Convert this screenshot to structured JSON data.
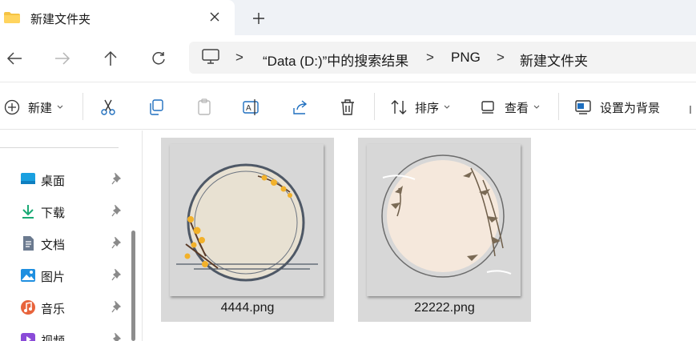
{
  "tab": {
    "title": "新建文件夹",
    "close_glyph": "✕",
    "new_tab_glyph": "+"
  },
  "address": {
    "crumbs": [
      "“Data (D:)”中的搜索结果",
      "PNG",
      "新建文件夹"
    ],
    "separator": ">"
  },
  "commands": {
    "new_label": "新建",
    "sort_label": "排序",
    "view_label": "查看",
    "wallpaper_label": "设置为背景"
  },
  "sidebar": {
    "items": [
      {
        "label": "桌面",
        "icon": "desktop-icon",
        "color": "#1aa0e0"
      },
      {
        "label": "下载",
        "icon": "download-icon",
        "color": "#19a974"
      },
      {
        "label": "文档",
        "icon": "document-icon",
        "color": "#6b7a8f"
      },
      {
        "label": "图片",
        "icon": "pictures-icon",
        "color": "#1f8fe0"
      },
      {
        "label": "音乐",
        "icon": "music-icon",
        "color": "#e8643c"
      },
      {
        "label": "视频",
        "icon": "video-icon",
        "color": "#8a4bd8"
      }
    ]
  },
  "files": [
    {
      "name": "4444.png",
      "selected": true
    },
    {
      "name": "22222.png",
      "selected": true
    }
  ],
  "colors": {
    "accent": "#0067c0",
    "selection": "#d9d9d9",
    "folder": "#f5c343"
  }
}
